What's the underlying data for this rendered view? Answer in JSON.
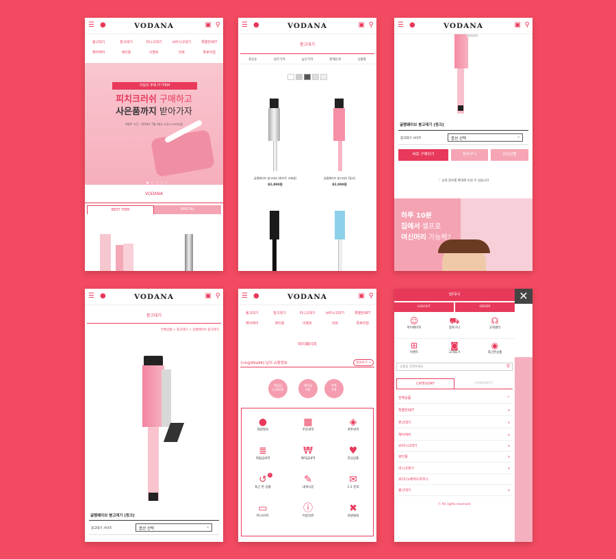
{
  "brand": "VODANA",
  "colors": {
    "background": "#f24a60",
    "accent": "#e8395a",
    "soft_pink": "#f8a9b7"
  },
  "icons": {
    "menu": "hamburger-icon",
    "user": "user-icon",
    "cart": "cart-icon",
    "search": "search-icon",
    "close": "close-icon"
  },
  "nav": [
    "봉고데기",
    "판고데기",
    "미니고데기",
    "브러시고데기",
    "특별한SET",
    "헤어케어",
    "뷰티툴",
    "이벤트",
    "리뷰",
    "특후리얼"
  ],
  "s1": {
    "banner_tag": "이달의 주목 IT ITEM",
    "banner_line1_a": "피치크러쉬",
    "banner_line1_b": " 구매하고",
    "banner_line2_a": "사은품까지",
    "banner_line2_b": " 받아가자",
    "banner_note": "이벤트 기간 : 2018년 7월 (재고 소진시 조기마감)",
    "section_title": "VODANA",
    "tab_best": "BEST ITEM",
    "tab_special": "SPECIAL"
  },
  "s2": {
    "category_title": "봉고데기",
    "sort": [
      "최신순",
      "낮은가격",
      "높은가격",
      "판매순위",
      "상품평"
    ],
    "products": [
      {
        "name": "글램웨이브 봉고데기 [화이트 스페셜]",
        "price": "82,000원"
      },
      {
        "name": "글램웨이브 봉고데기 [핑크]",
        "price": "82,000원"
      }
    ]
  },
  "s3": {
    "product_title": "글램웨이브 봉고데기 [핑크]",
    "option_label": "봉고데기 사이즈",
    "option_value": "옵션 선택",
    "buy_now": "바로 구매하기",
    "cart": "장바구니",
    "wishlist": "관심상품",
    "zoom_hint": "상세 정보를 확대해 보실 수 있습니다",
    "promo_1": "하루 10분",
    "promo_2a": "집에서",
    "promo_2b": " 셀프로",
    "promo_3a": "여신머리",
    "promo_3b": " 가능해?"
  },
  "s4": {
    "category_title": "봉고데기",
    "breadcrumb": "전체상품 > 봉고데기 > 글램웨이브 봉고데기",
    "product_title": "글램웨이브 봉고데기 [핑크]",
    "option_label": "봉고데기 사이즈",
    "option_value": "옵션 선택"
  },
  "s5": {
    "page_title": "마이페이지",
    "greeting": "[nh@99a96] 님의 쇼핑정보",
    "view_more": "정보보기 >",
    "circles": [
      {
        "label": "적립금",
        "value": "1,000원"
      },
      {
        "label": "예치금",
        "value": "0원"
      },
      {
        "label": "쿠폰",
        "value": "0개"
      }
    ],
    "menu": [
      "회원정보",
      "주문내역",
      "쿠폰내역",
      "적립금내역",
      "예치금내역",
      "관심상품",
      "최근 본 상품",
      "내게시글",
      "1:1 문의",
      "PC사이트",
      "이용약관",
      "회원탈퇴"
    ],
    "recent_badge": "!"
  },
  "s6": {
    "user": "보다나",
    "logout": "LOGOUT",
    "order": "ORDER",
    "shortcuts": [
      "마이페이지",
      "장바구니",
      "고객센터",
      "이벤트",
      "고객후기",
      "최근본상품"
    ],
    "search_placeholder": "상품을 검색하세요",
    "tab_category": "CATEGORY",
    "tab_community": "COMMUNITY",
    "categories": [
      "전체상품",
      "특별한SET",
      "판고데기",
      "헤어케어",
      "브러시고데기",
      "뷰티툴",
      "미니고데기",
      "보다나x에뛰드하우스",
      "봉고데기"
    ],
    "footer": "ⓒ All rights reserved."
  }
}
